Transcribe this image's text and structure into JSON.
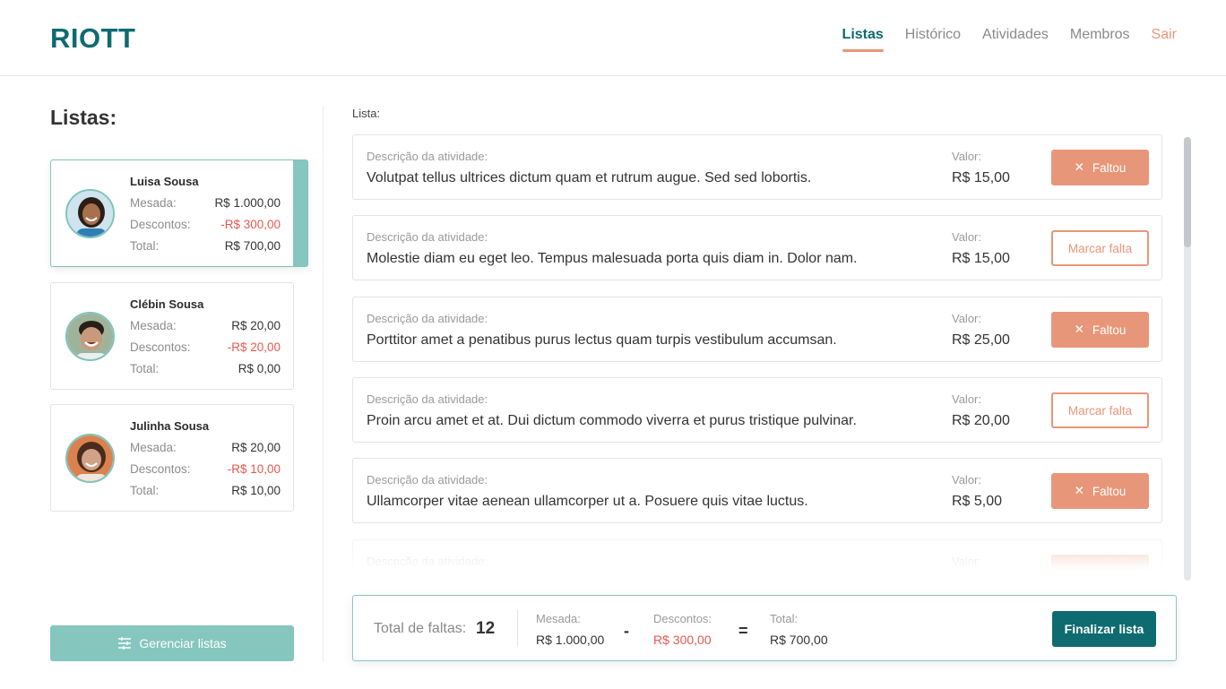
{
  "app": {
    "logo": "RIOTT"
  },
  "nav": {
    "items": [
      "Listas",
      "Histórico",
      "Atividades",
      "Membros"
    ],
    "logout": "Sair"
  },
  "sidebar": {
    "title": "Listas:",
    "labels": {
      "mesada": "Mesada:",
      "descontos": "Descontos:",
      "total": "Total:"
    },
    "members": [
      {
        "name": "Luisa Sousa",
        "mesada": "R$ 1.000,00",
        "descontos": "-R$ 300,00",
        "total": "R$ 700,00",
        "avatar": "girl-avatar"
      },
      {
        "name": "Clébin Sousa",
        "mesada": "R$ 20,00",
        "descontos": "-R$ 20,00",
        "total": "R$ 0,00",
        "avatar": "boy-avatar"
      },
      {
        "name": "Julinha Sousa",
        "mesada": "R$ 20,00",
        "descontos": "-R$ 10,00",
        "total": "R$ 10,00",
        "avatar": "girl-avatar"
      }
    ],
    "manage_button": "Gerenciar listas"
  },
  "list": {
    "label": "Lista:",
    "description_label": "Descrição da atividade:",
    "value_label": "Valor:",
    "faltou_label": "Faltou",
    "marcar_label": "Marcar falta",
    "activities": [
      {
        "description": "Volutpat tellus ultrices dictum quam et rutrum augue. Sed sed lobortis.",
        "value": "R$ 15,00",
        "status": "faltou"
      },
      {
        "description": "Molestie diam eu eget leo. Tempus malesuada porta quis diam in. Dolor nam.",
        "value": "R$ 15,00",
        "status": "marcar"
      },
      {
        "description": "Porttitor amet a penatibus purus lectus quam turpis vestibulum accumsan.",
        "value": "R$ 25,00",
        "status": "faltou"
      },
      {
        "description": "Proin arcu amet et at. Dui dictum commodo viverra et purus tristique pulvinar.",
        "value": "R$ 20,00",
        "status": "marcar"
      },
      {
        "description": "Ullamcorper vitae aenean ullamcorper ut a. Posuere quis vitae luctus.",
        "value": "R$ 5,00",
        "status": "faltou"
      }
    ]
  },
  "summary": {
    "faltas_label": "Total de faltas:",
    "faltas_count": "12",
    "mesada_label": "Mesada:",
    "mesada_value": "R$ 1.000,00",
    "minus": "-",
    "descontos_label": "Descontos:",
    "descontos_value": "R$ 300,00",
    "equals": "=",
    "total_label": "Total:",
    "total_value": "R$ 700,00",
    "finalize_button": "Finalizar lista"
  },
  "colors": {
    "brand": "#0e6b70",
    "accent": "#e8967a",
    "teal_light": "#85c6bf",
    "negative": "#e5574f"
  }
}
